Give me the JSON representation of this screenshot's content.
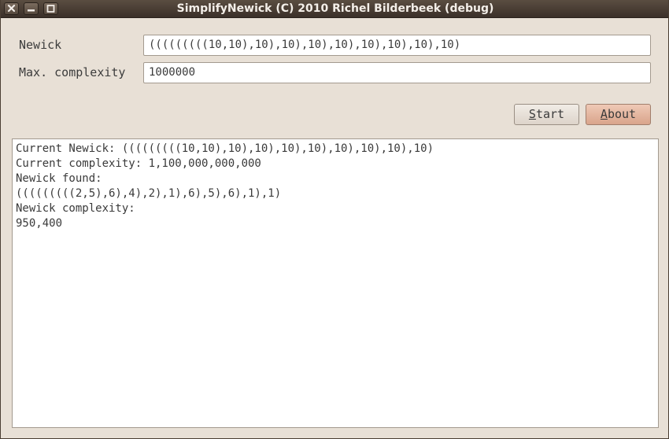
{
  "window": {
    "title": "SimplifyNewick (C) 2010 Richel Bilderbeek (debug)",
    "controls": [
      "close-icon",
      "minimize-icon",
      "maximize-icon"
    ]
  },
  "form": {
    "newick_label": "Newick",
    "newick_value": "(((((((((10,10),10),10),10),10),10),10),10),10)",
    "max_complexity_label": "Max. complexity",
    "max_complexity_value": "1000000"
  },
  "buttons": {
    "start": {
      "mnemonic": "S",
      "rest": "tart"
    },
    "about": {
      "mnemonic": "A",
      "rest": "bout"
    }
  },
  "output": {
    "lines": [
      "Current Newick: (((((((((10,10),10),10),10),10),10),10),10),10)",
      "Current complexity: 1,100,000,000,000",
      "Newick found:",
      "(((((((((2,5),6),4),2),1),6),5),6),1),1)",
      "Newick complexity:",
      "950,400"
    ]
  },
  "colors": {
    "window_bg": "#e8e0d6",
    "titlebar": "#3b3029",
    "about_button": "#d9a48b"
  }
}
